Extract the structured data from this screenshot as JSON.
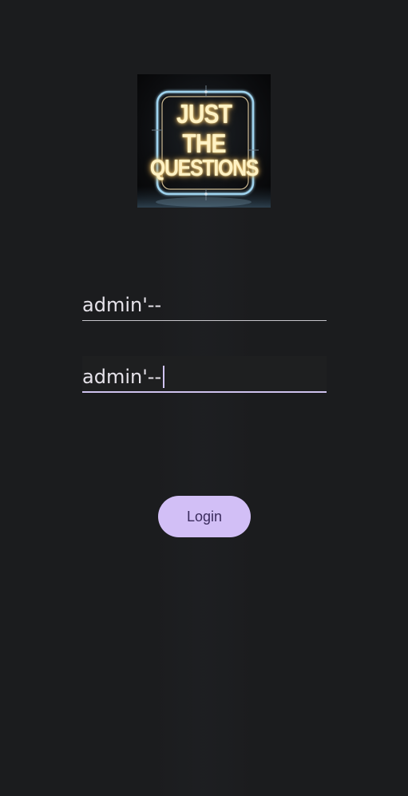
{
  "logo": {
    "lines": [
      "JUST",
      "THE",
      "QUESTIONS"
    ]
  },
  "form": {
    "username_value": "admin'--",
    "password_value": "admin'--",
    "login_label": "Login"
  },
  "colors": {
    "background": "#1b1c1e",
    "accent": "#d2bff6",
    "button_text": "#3a2b5d",
    "input_text": "#e6e3ea"
  }
}
